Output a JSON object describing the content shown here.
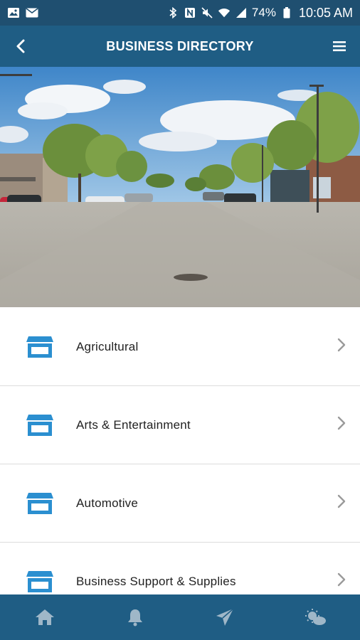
{
  "status_bar": {
    "battery": "74%",
    "time": "10:05 AM",
    "icons": [
      "image-icon",
      "mail-icon",
      "bluetooth-icon",
      "nfc-icon",
      "mute-icon",
      "wifi-icon",
      "signal-icon",
      "battery-icon"
    ]
  },
  "header": {
    "title": "BUSINESS DIRECTORY",
    "back_icon": "chevron-left-icon",
    "menu_icon": "hamburger-menu-icon"
  },
  "hero": {
    "description_icon": "street-photo"
  },
  "categories": [
    {
      "label": "Agricultural",
      "icon": "storefront-icon"
    },
    {
      "label": "Arts & Entertainment",
      "icon": "storefront-icon"
    },
    {
      "label": "Automotive",
      "icon": "storefront-icon"
    },
    {
      "label": "Business Support & Supplies",
      "icon": "storefront-icon"
    }
  ],
  "bottom_nav": {
    "items": [
      "home-icon",
      "bell-icon",
      "send-icon",
      "weather-icon"
    ]
  },
  "colors": {
    "status_bar": "#1f4f70",
    "app_bar": "#1f5d84",
    "accent_icon": "#2b8fd0",
    "chevron": "#9a9a9a"
  }
}
